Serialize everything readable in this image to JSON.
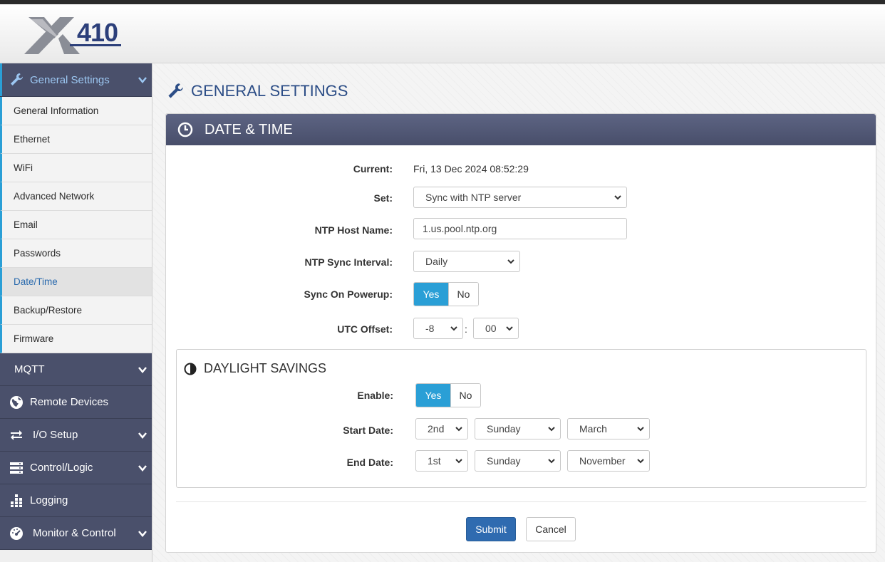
{
  "header": {
    "logo_alt": "X-410"
  },
  "sidebar": {
    "groups": [
      {
        "label": "General Settings",
        "icon": "wrench-icon",
        "expanded": true,
        "items": [
          {
            "label": "General Information"
          },
          {
            "label": "Ethernet"
          },
          {
            "label": "WiFi"
          },
          {
            "label": "Advanced Network"
          },
          {
            "label": "Email"
          },
          {
            "label": "Passwords"
          },
          {
            "label": "Date/Time",
            "active": true
          },
          {
            "label": "Backup/Restore"
          },
          {
            "label": "Firmware"
          }
        ]
      },
      {
        "label": "MQTT",
        "icon": "none"
      },
      {
        "label": "Remote Devices",
        "icon": "globe-icon"
      },
      {
        "label": "I/O Setup",
        "icon": "transfer-arrows-icon"
      },
      {
        "label": "Control/Logic",
        "icon": "server-icon"
      },
      {
        "label": "Logging",
        "icon": "bars-icon"
      },
      {
        "label": "Monitor & Control",
        "icon": "gauge-icon"
      }
    ]
  },
  "page": {
    "title": "GENERAL SETTINGS"
  },
  "panel": {
    "title": "DATE & TIME"
  },
  "form": {
    "current_label": "Current:",
    "current_value": "Fri, 13 Dec 2024 08:52:29",
    "set_label": "Set:",
    "set_value": "Sync with NTP server",
    "ntp_host_label": "NTP Host Name:",
    "ntp_host_value": "1.us.pool.ntp.org",
    "ntp_interval_label": "NTP Sync Interval:",
    "ntp_interval_value": "Daily",
    "sync_powerup_label": "Sync On Powerup:",
    "sync_powerup_yes": "Yes",
    "sync_powerup_no": "No",
    "sync_powerup_selected": "Yes",
    "utc_label": "UTC Offset:",
    "utc_hours": "-8",
    "utc_separator": ":",
    "utc_minutes": "00"
  },
  "dst": {
    "title": "DAYLIGHT SAVINGS",
    "enable_label": "Enable:",
    "enable_yes": "Yes",
    "enable_no": "No",
    "enable_selected": "Yes",
    "start_label": "Start Date:",
    "start_week": "2nd",
    "start_day": "Sunday",
    "start_month": "March",
    "end_label": "End Date:",
    "end_week": "1st",
    "end_day": "Sunday",
    "end_month": "November"
  },
  "buttons": {
    "submit": "Submit",
    "cancel": "Cancel"
  },
  "colors": {
    "accent": "#2a9fd6",
    "nav_bg": "#4a506b",
    "title": "#2c4d86",
    "submit": "#2f6bb0"
  }
}
